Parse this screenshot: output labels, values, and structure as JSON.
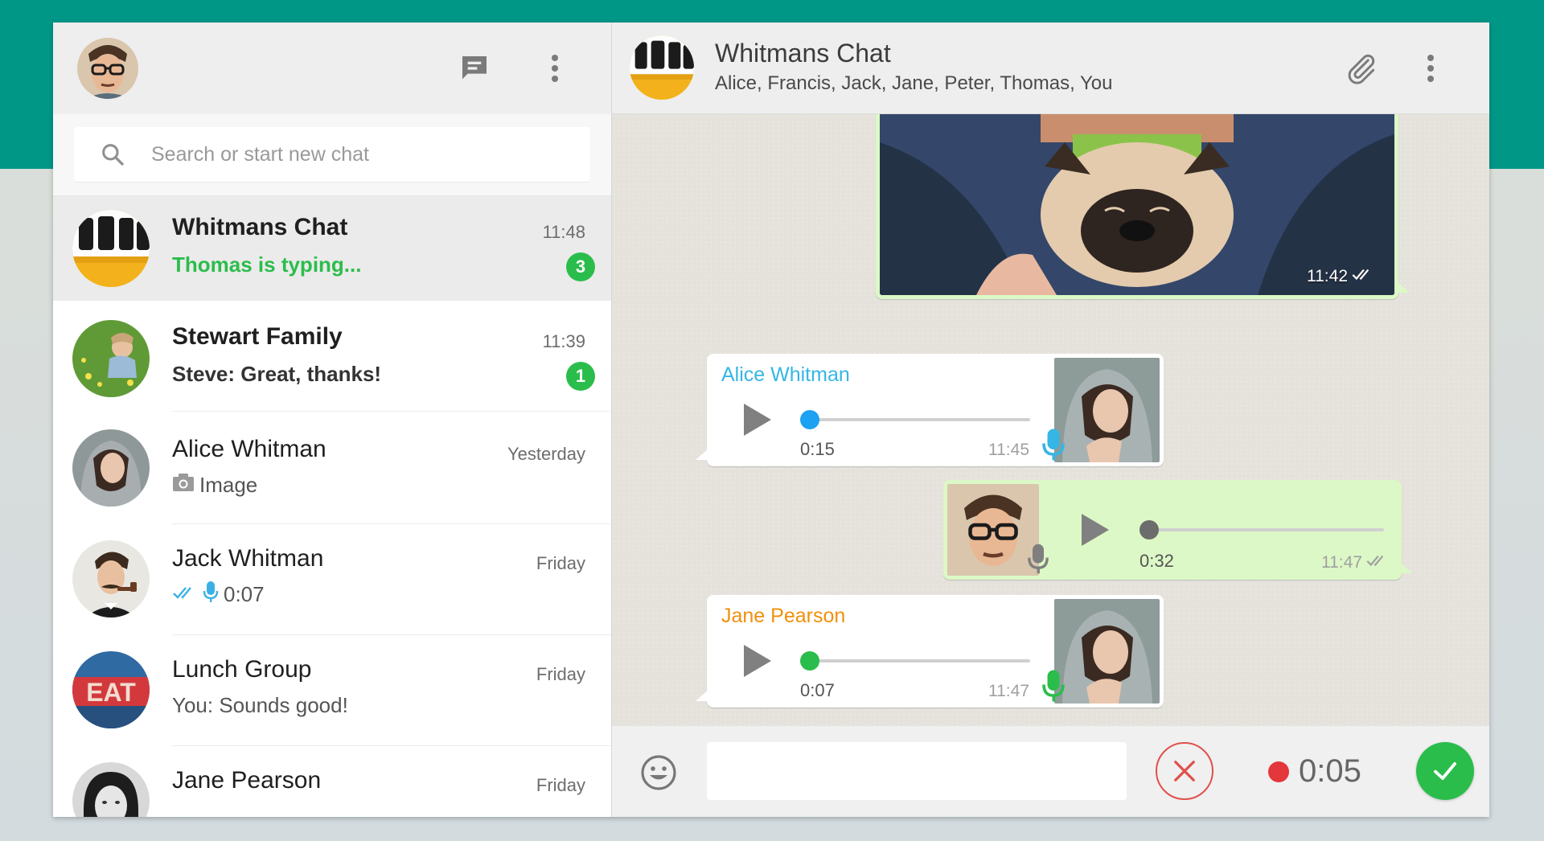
{
  "search": {
    "placeholder": "Search or start new chat"
  },
  "chats": [
    {
      "name": "Whitmans Chat",
      "time": "11:48",
      "preview": "Thomas is typing...",
      "unread": "3"
    },
    {
      "name": "Stewart Family",
      "time": "11:39",
      "preview": "Steve: Great, thanks!",
      "unread": "1"
    },
    {
      "name": "Alice Whitman",
      "time": "Yesterday",
      "preview": "Image"
    },
    {
      "name": "Jack Whitman",
      "time": "Friday",
      "preview": "0:07"
    },
    {
      "name": "Lunch Group",
      "time": "Friday",
      "preview": "You: Sounds good!"
    },
    {
      "name": "Jane Pearson",
      "time": "Friday"
    }
  ],
  "conversation": {
    "title": "Whitmans Chat",
    "participants": "Alice, Francis, Jack, Jane, Peter, Thomas, You"
  },
  "messages": [
    {
      "type": "image",
      "time": "11:42"
    },
    {
      "type": "voice",
      "sender": "Alice Whitman",
      "duration": "0:15",
      "time": "11:45",
      "sender_color": "#35b6e4",
      "knob_color": "#1da1f2",
      "progress": 0.0
    },
    {
      "type": "voice",
      "duration": "0:32",
      "time": "11:47",
      "knob_color": "#6c6c6c",
      "progress": 0.0
    },
    {
      "type": "voice",
      "sender": "Jane Pearson",
      "duration": "0:07",
      "time": "11:47",
      "sender_color": "#f0900e",
      "knob_color": "#2bbd4b",
      "progress": 0.0
    }
  ],
  "recorder": {
    "elapsed": "0:05"
  },
  "colors": {
    "accent_teal": "#009787",
    "green": "#2bbd4b",
    "outgoing_bubble": "#dcf8c6",
    "record_red": "#e3373b"
  }
}
